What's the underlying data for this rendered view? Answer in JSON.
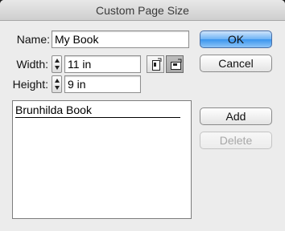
{
  "dialog": {
    "title": "Custom Page Size",
    "name_label": "Name:",
    "name_value": "My Book",
    "width_label": "Width:",
    "width_value": "11 in",
    "height_label": "Height:",
    "height_value": "9 in",
    "orientation": {
      "selected": "landscape",
      "options": [
        "portrait",
        "landscape"
      ]
    },
    "list_items": [
      "Brunhilda Book"
    ],
    "buttons": {
      "ok": "OK",
      "cancel": "Cancel",
      "add": "Add",
      "delete": "Delete"
    }
  }
}
